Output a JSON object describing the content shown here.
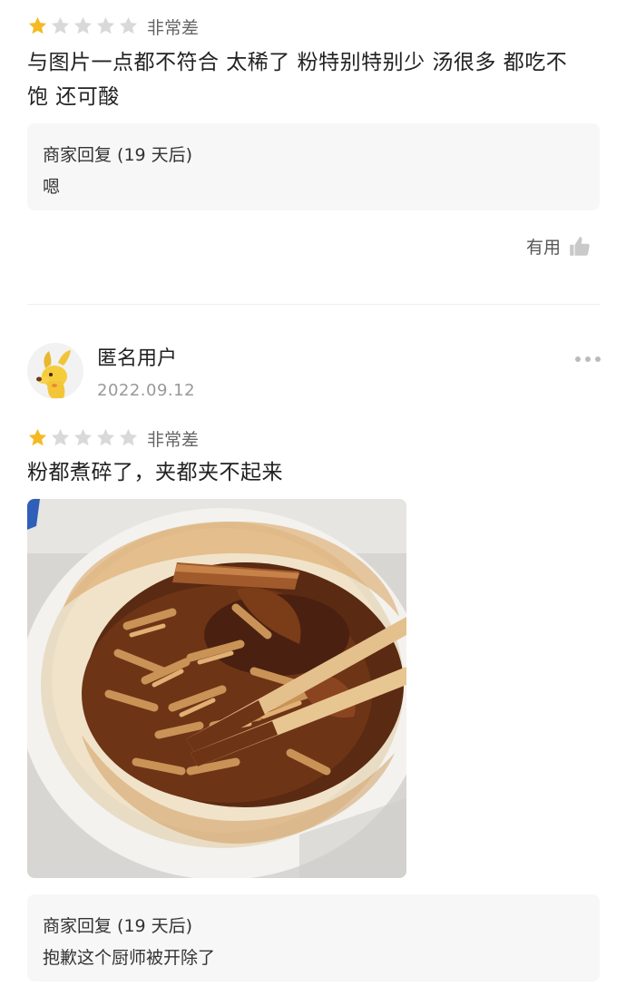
{
  "review1": {
    "rating": 1,
    "max_rating": 5,
    "rating_label": "非常差",
    "text_line1": "与图片一点都不符合 太稀了 粉特别特别少 汤很多 都吃不",
    "text_line2": "饱 还可酸",
    "reply_title": "商家回复 (19 天后)",
    "reply_text": "嗯",
    "helpful_label": "有用"
  },
  "review2": {
    "user_name": "匿名用户",
    "date": "2022.09.12",
    "rating": 1,
    "max_rating": 5,
    "rating_label": "非常差",
    "text": "粉都煮碎了，夹都夹不起来",
    "reply_title": "商家回复 (19 天后)",
    "reply_text": "抱歉这个厨师被开除了"
  },
  "colors": {
    "star_filled": "#f5b923",
    "star_empty": "#d9d9d9"
  },
  "icons": [
    "star-icon",
    "thumbs-up-icon",
    "more-dots-icon",
    "avatar-dog-icon"
  ]
}
